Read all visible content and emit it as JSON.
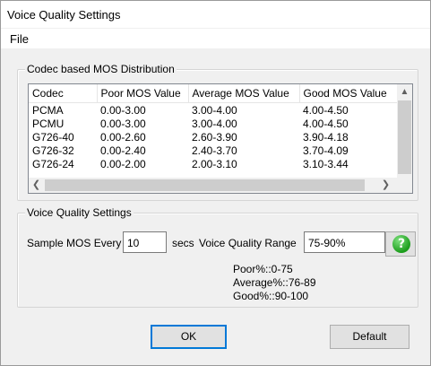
{
  "window": {
    "title": "Voice Quality Settings"
  },
  "menu": {
    "file": "File"
  },
  "codec_group": {
    "label": "Codec based  MOS Distribution",
    "columns": [
      "Codec",
      "Poor MOS Value",
      "Average MOS Value",
      "Good MOS Value"
    ],
    "rows": [
      [
        "PCMA",
        "0.00-3.00",
        "3.00-4.00",
        "4.00-4.50"
      ],
      [
        "PCMU",
        "0.00-3.00",
        "3.00-4.00",
        "4.00-4.50"
      ],
      [
        "G726-40",
        "0.00-2.60",
        "2.60-3.90",
        "3.90-4.18"
      ],
      [
        "G726-32",
        "0.00-2.40",
        "2.40-3.70",
        "3.70-4.09"
      ],
      [
        "G726-24",
        "0.00-2.00",
        "2.00-3.10",
        "3.10-3.44"
      ]
    ]
  },
  "vq_group": {
    "label": "Voice Quality Settings",
    "sample_label": "Sample MOS Every",
    "sample_value": "10",
    "secs_label": "secs",
    "range_label": "Voice Quality Range",
    "range_value": "75-90%",
    "help_icon": "question-icon",
    "ranges": [
      "Poor%::0-75",
      "Average%::76-89",
      "Good%::90-100"
    ]
  },
  "buttons": {
    "ok": "OK",
    "default": "Default"
  }
}
